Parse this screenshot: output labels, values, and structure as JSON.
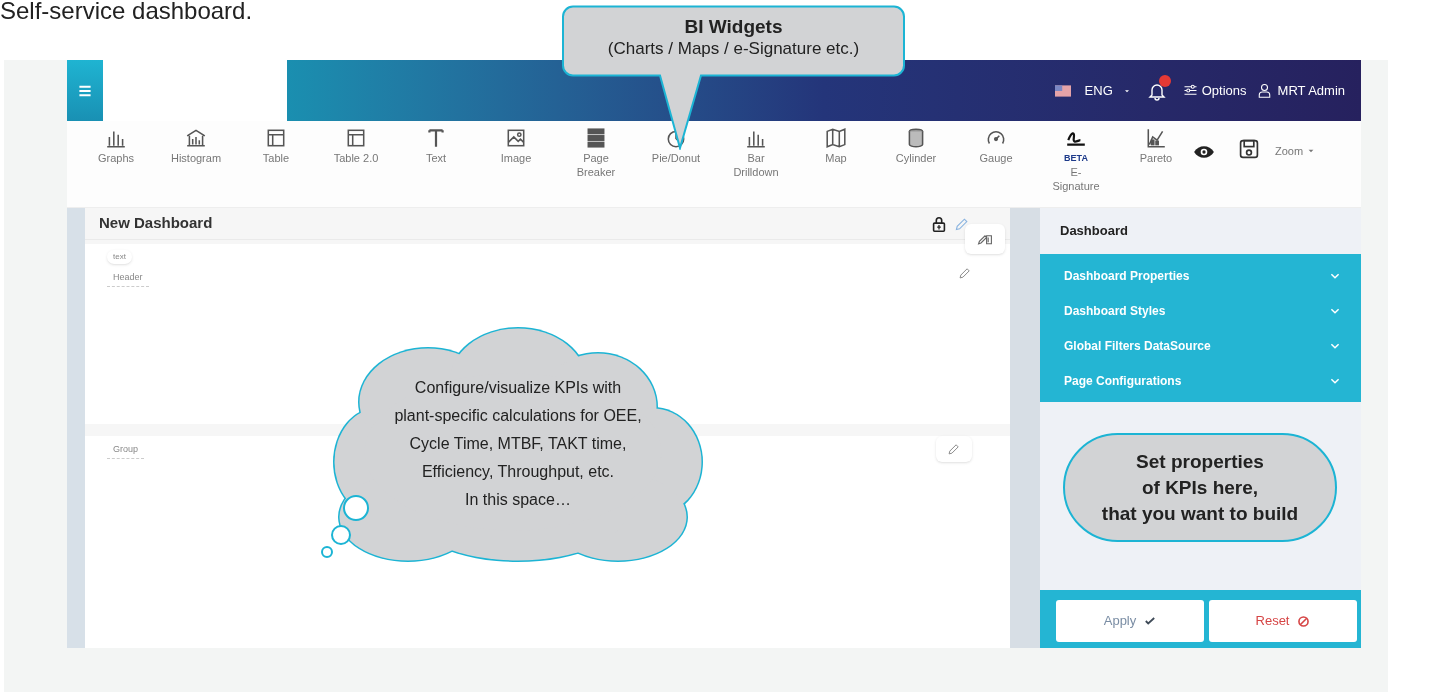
{
  "heading": "Self-service dashboard.",
  "top_bar": {
    "language": "ENG",
    "options": "Options",
    "user": "MRT Admin",
    "notification_badge": true
  },
  "toolbar": {
    "widgets": [
      {
        "label": "Graphs"
      },
      {
        "label": "Histogram"
      },
      {
        "label": "Table"
      },
      {
        "label": "Table 2.0"
      },
      {
        "label": "Text"
      },
      {
        "label": "Image"
      },
      {
        "label": "Page Breaker"
      },
      {
        "label": "Pie/Donut"
      },
      {
        "label": "Bar Drilldown"
      },
      {
        "label": "Map"
      },
      {
        "label": "Cylinder"
      },
      {
        "label": "Gauge"
      },
      {
        "label": "E-Signature",
        "badge": "BETA"
      },
      {
        "label": "Pareto"
      }
    ],
    "zoom": "Zoom"
  },
  "canvas": {
    "title": "New Dashboard",
    "sections": [
      {
        "tag": "text",
        "label": "Header"
      },
      {
        "label": "Group"
      }
    ]
  },
  "properties_panel": {
    "title": "Dashboard",
    "accordion": [
      {
        "label": "Dashboard Properties",
        "expanded": false
      },
      {
        "label": "Dashboard Styles",
        "expanded": false
      },
      {
        "label": "Global Filters DataSource",
        "expanded": false
      },
      {
        "label": "Page Configurations",
        "expanded": false
      }
    ],
    "buttons": [
      {
        "label": "Apply",
        "kind": "apply"
      },
      {
        "label": "Reset",
        "kind": "reset"
      }
    ]
  },
  "callouts": [
    {
      "kind": "speech",
      "title": "BI Widgets",
      "lines": [
        "(Charts / Maps / e-Signature etc.)"
      ]
    },
    {
      "kind": "cloud",
      "lines": [
        "Configure/visualize KPIs with",
        "plant-specific calculations for OEE,",
        "Cycle Time, MTBF, TAKT time,",
        "Efficiency, Throughput, etc.",
        "In this space…"
      ]
    },
    {
      "kind": "pill",
      "lines": [
        "Set properties",
        "of KPIs here,",
        "that you want to build"
      ]
    }
  ]
}
